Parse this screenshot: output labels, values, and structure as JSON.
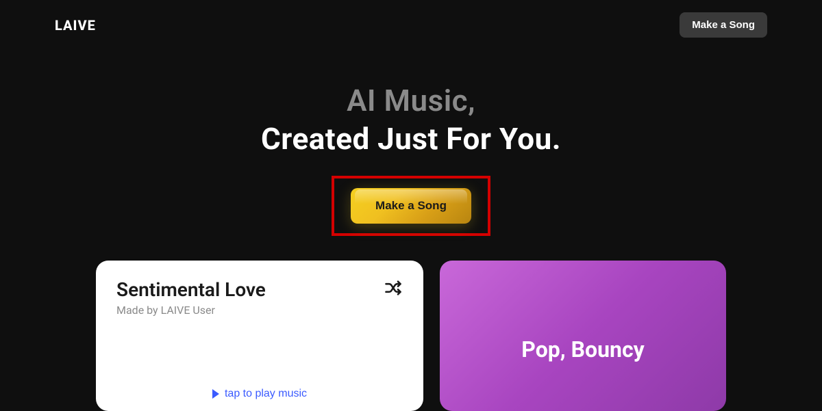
{
  "header": {
    "logo": "LAIVE",
    "cta_label": "Make a Song"
  },
  "hero": {
    "line1": "AI Music,",
    "line2": "Created Just For You.",
    "cta_label": "Make a Song"
  },
  "cards": {
    "song": {
      "title": "Sentimental Love",
      "subtitle": "Made by LAIVE User",
      "play_label": "tap to play music"
    },
    "genre": {
      "label": "Pop, Bouncy"
    }
  }
}
